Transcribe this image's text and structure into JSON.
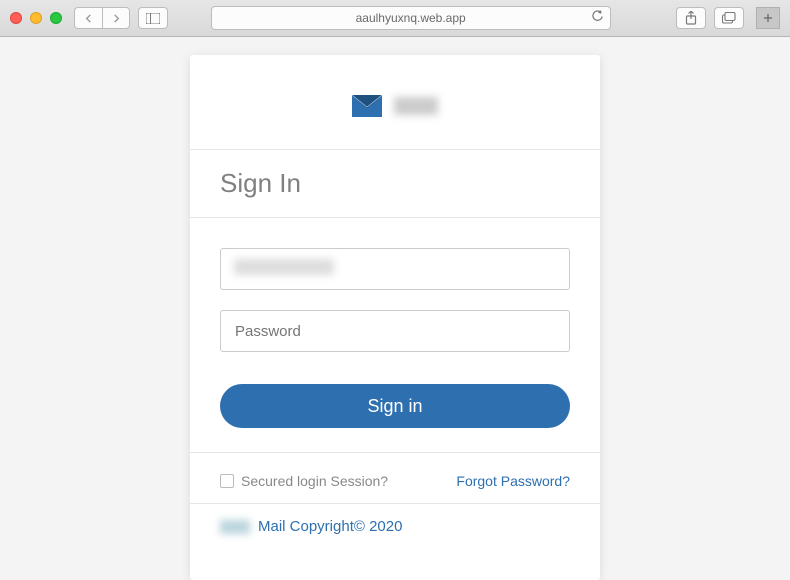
{
  "browser": {
    "url": "aaulhyuxnq.web.app"
  },
  "login": {
    "title": "Sign In",
    "email_placeholder": "",
    "password_placeholder": "Password",
    "submit_label": "Sign in",
    "secured_label": "Secured login Session?",
    "forgot_label": "Forgot Password?",
    "copyright": "Mail Copyright© 2020"
  }
}
